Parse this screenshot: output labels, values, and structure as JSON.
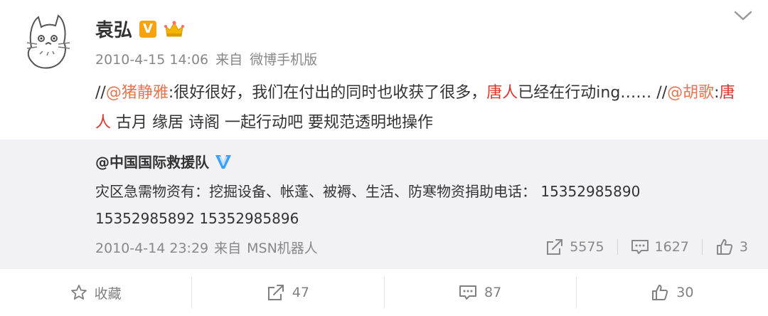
{
  "post": {
    "author": "袁弘",
    "timestamp": "2010-4-15 14:06",
    "source_prefix": "来自",
    "source": "微博手机版",
    "content": {
      "prefix1": "//",
      "mention1": "@猪静雅",
      "text1": ":很好很好，我们在付出的同时也收获了很多，",
      "keyword1": "唐人",
      "text2": "已经在行动ing……  ",
      "prefix2": "//",
      "mention2": "@胡歌",
      "colon": ":",
      "keyword2": "唐人",
      "text3": " 古月 缘居 诗阁 一起行动吧 要规范透明地操作"
    }
  },
  "repost": {
    "author": "@中国国际救援队",
    "text": "灾区急需物资有：挖掘设备、帐蓬、被褥、生活、防寒物资捐助电话： 15352985890 15352985892 15352985896",
    "timestamp": "2010-4-14 23:29",
    "source_prefix": "来自",
    "source": "MSN机器人",
    "reposts": "5575",
    "comments": "1627",
    "likes": "3"
  },
  "actions": {
    "favorite_label": "收藏",
    "repost_count": "47",
    "comment_count": "87",
    "like_count": "30"
  },
  "icons": [
    "avatar-totoro",
    "verified-v-icon",
    "crown-icon",
    "chevron-down-icon",
    "star-icon",
    "share-icon",
    "comment-icon",
    "thumb-up-icon",
    "blue-verified-icon"
  ],
  "colors": {
    "mention": "#eb7350",
    "keyword": "#e0342b",
    "badge": "#f7a310",
    "repost_bg": "#f2f2f5"
  }
}
